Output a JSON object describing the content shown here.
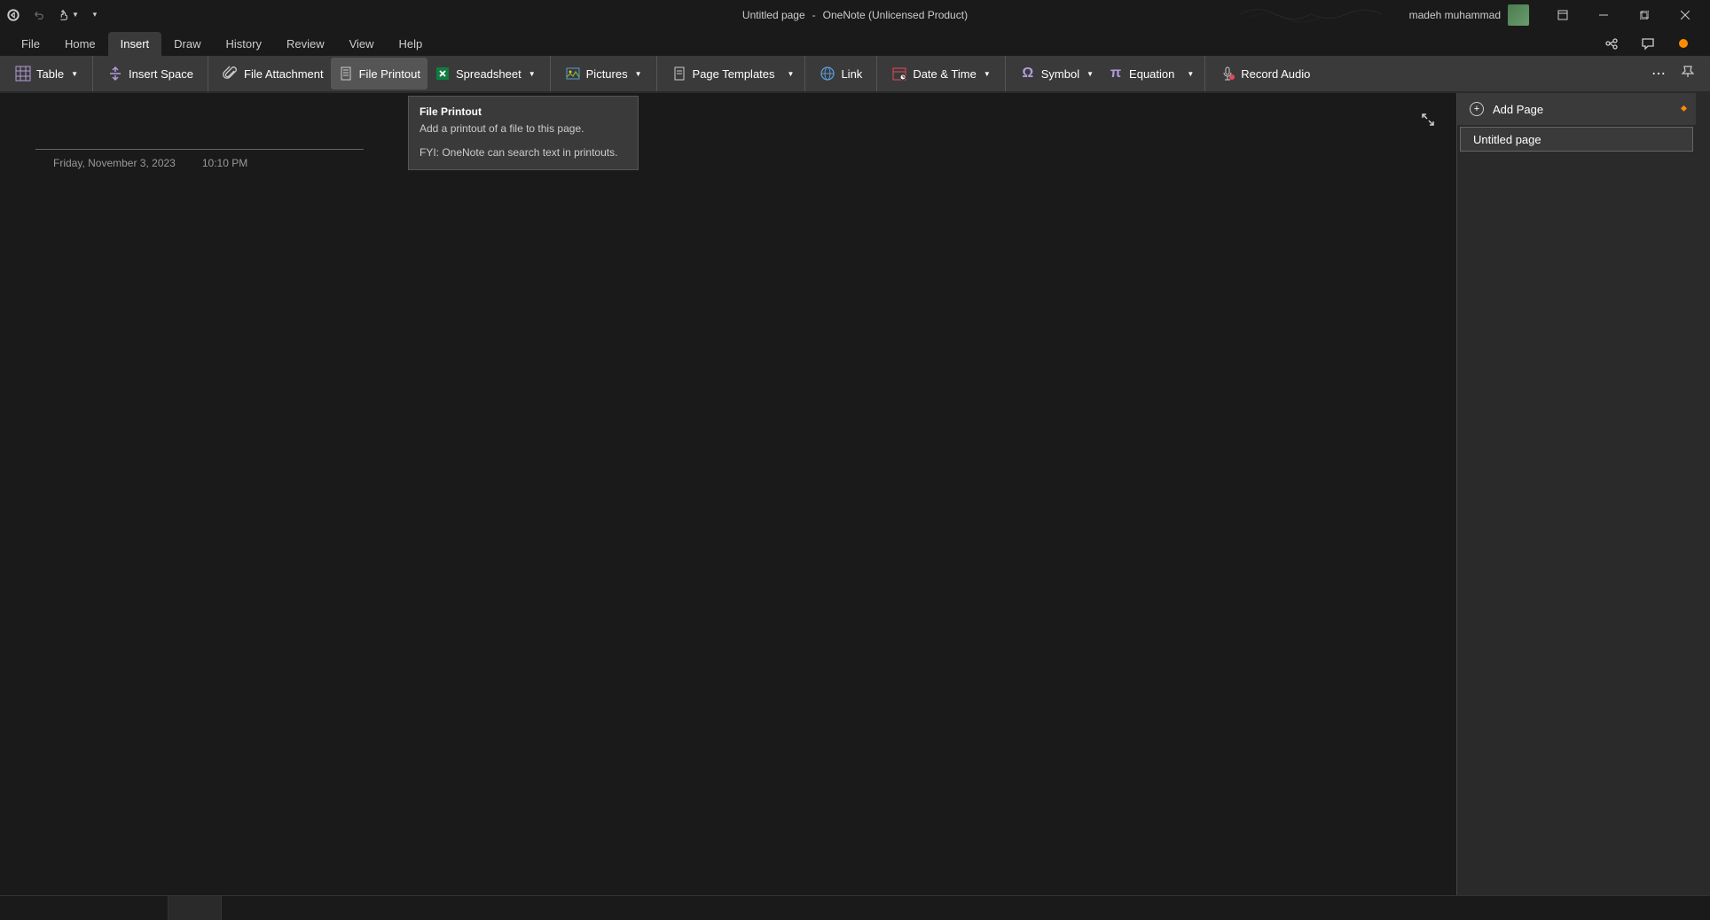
{
  "title_bar": {
    "document_title": "Untitled page",
    "separator": "-",
    "app_name": "OneNote (Unlicensed Product)",
    "user_name": "madeh muhammad"
  },
  "tabs": {
    "items": [
      "File",
      "Home",
      "Insert",
      "Draw",
      "History",
      "Review",
      "View",
      "Help"
    ],
    "active_index": 2
  },
  "ribbon": {
    "table_label": "Table",
    "insert_space_label": "Insert Space",
    "file_attachment_label": "File Attachment",
    "file_printout_label": "File Printout",
    "spreadsheet_label": "Spreadsheet",
    "pictures_label": "Pictures",
    "page_templates_label": "Page Templates",
    "link_label": "Link",
    "date_time_label": "Date & Time",
    "symbol_label": "Symbol",
    "equation_label": "Equation",
    "record_audio_label": "Record Audio"
  },
  "tooltip": {
    "title": "File Printout",
    "description": "Add a printout of a file to this page.",
    "note": "FYI: OneNote can search text in printouts."
  },
  "page": {
    "title_placeholder": "",
    "date": "Friday, November 3, 2023",
    "time": "10:10 PM"
  },
  "side_panel": {
    "add_page_label": "Add Page",
    "page_items": [
      "Untitled page"
    ]
  }
}
